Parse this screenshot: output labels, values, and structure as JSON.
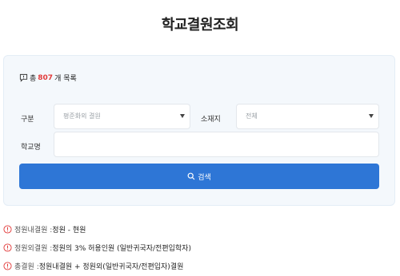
{
  "page": {
    "title": "학교결원조회"
  },
  "summary": {
    "prefix": "총 ",
    "count": "807",
    "suffix": "개 목록"
  },
  "form": {
    "division": {
      "label": "구분",
      "value": "평준화외 결원"
    },
    "location": {
      "label": "소재지",
      "value": "전체"
    },
    "school_name": {
      "label": "학교명",
      "value": "",
      "placeholder": ""
    },
    "search_label": "검색"
  },
  "notes": [
    {
      "term": "정원내결원 : ",
      "desc": "정원 - 현원"
    },
    {
      "term": "정원외결원 : ",
      "desc": "정원의 3% 허용인원 (일반귀국자/전편입학자)"
    },
    {
      "term": "총결원 : ",
      "desc": "정원내결원 + 정원외(일반귀국자/전편입자)결원"
    }
  ],
  "colors": {
    "accent": "#2e76d6",
    "count": "#e23b3b",
    "warning": "#e23b3b"
  },
  "icons": {
    "summary": "chat-bubble-icon",
    "search": "search-icon",
    "note": "warning-circle-icon"
  }
}
